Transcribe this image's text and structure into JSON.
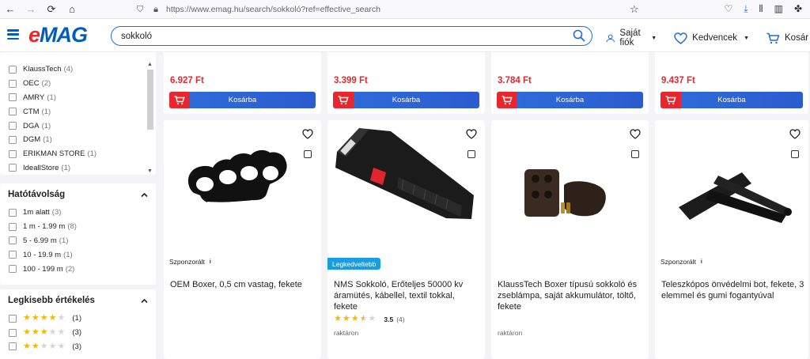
{
  "browser": {
    "url": "https://www.emag.hu/search/sokkoló?ref=effective_search",
    "back_icon": "arrow-left",
    "forward_icon": "arrow-right",
    "reload_icon": "reload",
    "home_icon": "home"
  },
  "header": {
    "logo": {
      "e": "e",
      "rest": "MAG"
    },
    "search": {
      "value": "sokkoló",
      "placeholder": ""
    },
    "account_label": "Saját fiók",
    "favorites_label": "Kedvencek",
    "cart_label": "Kosár"
  },
  "sidebar": {
    "sellers": [
      {
        "name": "KlaussTech",
        "count": "(4)"
      },
      {
        "name": "OEC",
        "count": "(2)"
      },
      {
        "name": "AMRY",
        "count": "(1)"
      },
      {
        "name": "CTM",
        "count": "(1)"
      },
      {
        "name": "DGA",
        "count": "(1)"
      },
      {
        "name": "DGM",
        "count": "(1)"
      },
      {
        "name": "ERIKMAN STORE",
        "count": "(1)"
      },
      {
        "name": "IdeallStore",
        "count": "(1)"
      }
    ],
    "range": {
      "title": "Hatótávolság",
      "items": [
        {
          "label": "1m alatt",
          "count": "(3)"
        },
        {
          "label": "1 m - 1.99 m",
          "count": "(8)"
        },
        {
          "label": "5 - 6.99 m",
          "count": "(1)"
        },
        {
          "label": "10 - 19.9 m",
          "count": "(1)"
        },
        {
          "label": "100 - 199 m",
          "count": "(2)"
        }
      ]
    },
    "rating": {
      "title": "Legkisebb értékelés",
      "items": [
        {
          "stars": 4,
          "count": "(1)"
        },
        {
          "stars": 3,
          "count": "(3)"
        },
        {
          "stars": 2,
          "count": "(3)"
        }
      ]
    }
  },
  "prices_row": [
    {
      "price": "6.927 Ft",
      "button": "Kosárba"
    },
    {
      "price": "3.399 Ft",
      "button": "Kosárba"
    },
    {
      "price": "3.784 Ft",
      "button": "Kosárba"
    },
    {
      "price": "9.437 Ft",
      "button": "Kosárba"
    }
  ],
  "products": [
    {
      "badge": "Szponzorált",
      "info": "i",
      "title": "OEM Boxer, 0,5 cm vastag, fekete"
    },
    {
      "badge": "Legkedveltebb",
      "title": "NMS Sokkoló, Erőteljes 50000 kv áramütés, kábellel, textil tokkal, fekete",
      "rating": "3.5",
      "rating_count": "(4)",
      "rating_value": 3.5,
      "stock": "raktáron"
    },
    {
      "title": "KlaussTech Boxer típusú sokkoló és zseblámpa, saját akkumulátor, töltő, fekete",
      "stock": "raktáron"
    },
    {
      "badge": "Szponzorált",
      "info": "i",
      "title": "Teleszkópos önvédelmi bot, fekete, 3 elemmel és gumi fogantyúval"
    }
  ]
}
